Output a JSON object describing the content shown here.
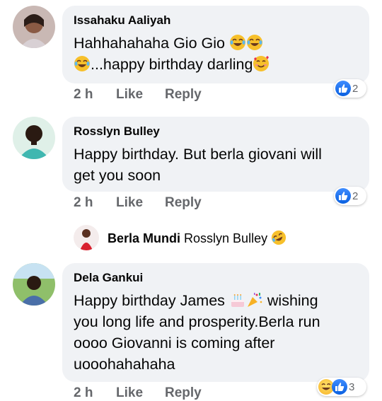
{
  "comments": [
    {
      "author": "Issahaku Aaliyah",
      "text_line1": "Hahhahahaha Gio Gio",
      "text_line2": "...happy birthday darling",
      "time": "2 h",
      "like": "Like",
      "reply": "Reply",
      "reaction_count": "2"
    },
    {
      "author": "Rosslyn Bulley",
      "text_line1": "Happy birthday. But berla giovani will",
      "text_line2": "get you soon",
      "time": "2 h",
      "like": "Like",
      "reply": "Reply",
      "reaction_count": "2"
    },
    {
      "author": "Dela Gankui",
      "text_line1": "Happy birthday James",
      "text_line1b": "wishing",
      "text_line2": "you long life and prosperity.Berla run",
      "text_line3": "oooo Giovanni is coming after",
      "text_line4": "uooohahahaha",
      "time": "2 h",
      "like": "Like",
      "reply": "Reply",
      "reaction_count": "3"
    }
  ],
  "reply_preview": {
    "author": "Berla Mundi",
    "text": "Rosslyn Bulley"
  },
  "icons": {
    "like_reaction": "like-reaction-icon",
    "haha_reaction": "haha-reaction-icon",
    "laughing_emoji": "tears-of-joy-emoji",
    "love_emoji": "smiling-face-hearts-emoji",
    "cake_emoji": "birthday-cake-emoji",
    "party_emoji": "party-popper-emoji",
    "rolling_laugh_emoji": "rolling-laughing-emoji"
  },
  "colors": {
    "bubble": "#f0f2f5",
    "meta_text": "#65676b",
    "like_blue": "#1877f2"
  }
}
